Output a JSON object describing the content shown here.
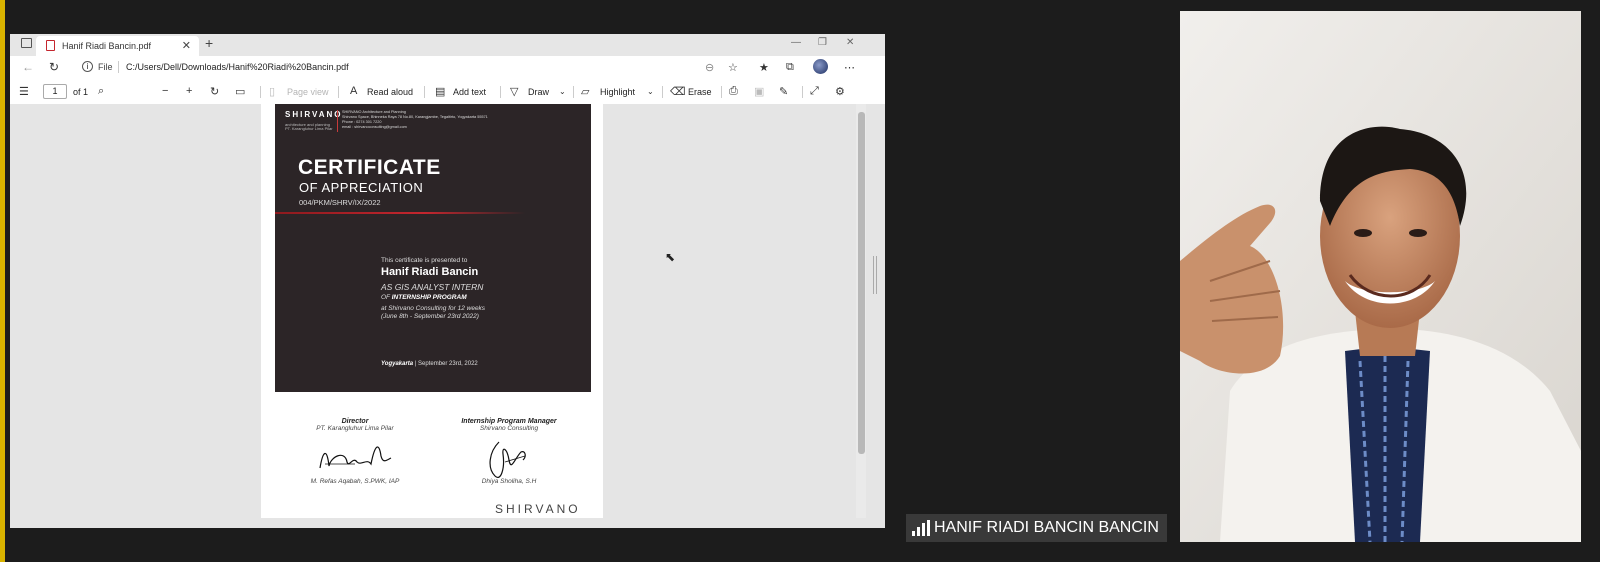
{
  "browser": {
    "tab_title": "Hanif Riadi Bancin.pdf",
    "tab_close": "✕",
    "new_tab": "+",
    "url_label": "File",
    "url": "C:/Users/Dell/Downloads/Hanif%20Riadi%20Bancin.pdf"
  },
  "pdf_toolbar": {
    "page_number": "1",
    "page_total": "of 1",
    "page_view": "Page view",
    "read_aloud": "Read aloud",
    "add_text": "Add text",
    "draw": "Draw",
    "highlight": "Highlight",
    "erase": "Erase"
  },
  "certificate": {
    "logo": "SHIRVANO",
    "logo_sub1": "architecture and planning",
    "logo_sub2": "PT. Karangluhur Lima Pilar",
    "info_line1": "SHIRVANO Architecture and Planning",
    "info_line2": "Shirvano Space, Bhinneka Raya 78 No.80, Karangjambe, Tegaltirto, Yogyakarta 55571",
    "info_line3": "Phone : 0274 301 7220",
    "info_line4": "email : shirvanoconsulting@gmail.com",
    "title": "CERTIFICATE",
    "subtitle": "OF APPRECIATION",
    "number": "004/PKM/SHRV/IX/2022",
    "presented": "This certificate is presented to",
    "recipient": "Hanif Riadi Bancin",
    "role": "AS GIS ANALYST INTERN",
    "program_of": "OF",
    "program": "INTERNSHIP PROGRAM",
    "at": "at Shirvano Consulting for 12 weeks",
    "dates": "(June 8th - September 23rd 2022)",
    "place": "Yogyakarta",
    "date": "| September 23rd, 2022",
    "sig1_role": "Director",
    "sig1_org": "PT. Karangluhur Lima Pilar",
    "sig1_name": "M. Refas Aqabah, S.PWK, IAP",
    "sig2_role": "Internship Program Manager",
    "sig2_org": "Shirvano Consulting",
    "sig2_name": "Dhiya Sholiha, S.H",
    "footer_logo": "SHIRVANO"
  },
  "participant": {
    "name": "HANIF RIADI BANCIN BANCIN"
  },
  "colors": {
    "accent_red": "#c4262e",
    "certificate_bg": "#2c2527",
    "app_bg": "#1c1c1c"
  }
}
